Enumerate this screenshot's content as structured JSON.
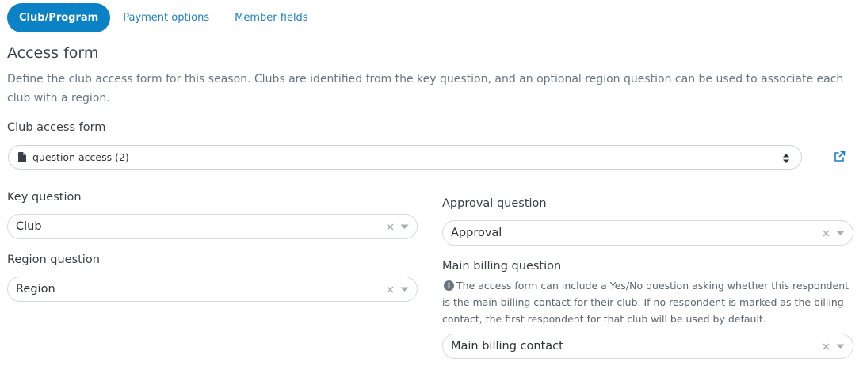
{
  "tabs": [
    {
      "label": "Club/Program",
      "active": true
    },
    {
      "label": "Payment options",
      "active": false
    },
    {
      "label": "Member fields",
      "active": false
    }
  ],
  "section": {
    "title": "Access form",
    "description": "Define the club access form for this season. Clubs are identified from the key question, and an optional region question can be used to associate each club with a region."
  },
  "club_access_form": {
    "label": "Club access form",
    "value": "question access (2)"
  },
  "key_question": {
    "label": "Key question",
    "value": "Club"
  },
  "region_question": {
    "label": "Region question",
    "value": "Region"
  },
  "approval_question": {
    "label": "Approval question",
    "value": "Approval"
  },
  "main_billing_question": {
    "label": "Main billing question",
    "hint": "The access form can include a Yes/No question asking whether this respondent is the main billing contact for their club. If no respondent is marked as the billing contact, the first respondent for that club will be used by default.",
    "value": "Main billing contact"
  },
  "colors": {
    "accent": "#0b81c6",
    "link": "#1a7fc0",
    "muted_text": "#6b7684"
  },
  "icons": {
    "file": "file-icon",
    "external_link": "external-link-icon",
    "clear": "clear-x-icon",
    "caret": "chevron-down-icon",
    "sort": "sort-arrows-icon",
    "info": "info-circle-icon"
  }
}
